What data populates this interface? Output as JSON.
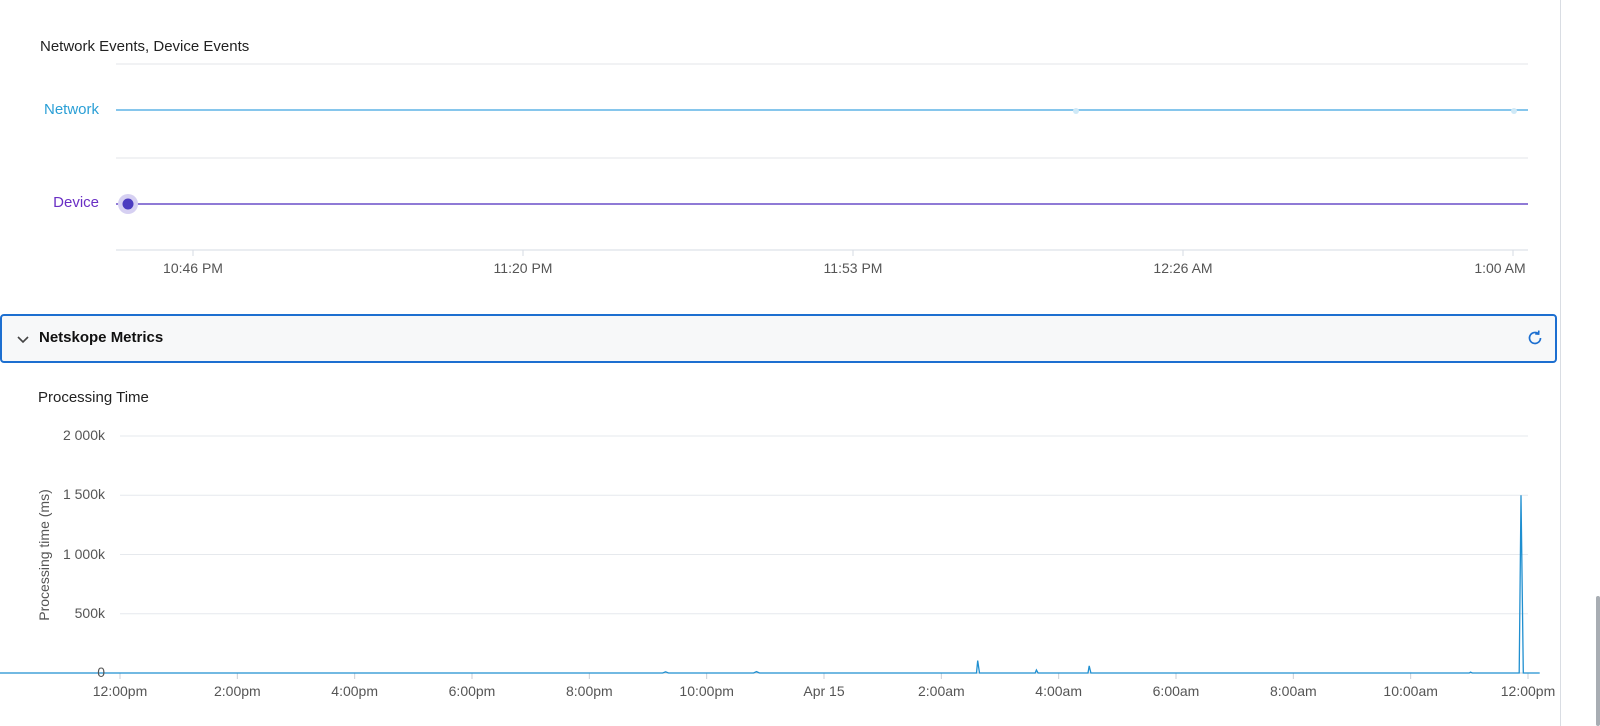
{
  "events_panel": {
    "title": "Network Events, Device Events",
    "lanes": [
      {
        "label": "Network",
        "color": "#2a9fd6"
      },
      {
        "label": "Device",
        "color": "#6a2fc4"
      }
    ],
    "time_ticks": [
      "10:46 PM",
      "11:20 PM",
      "11:53 PM",
      "12:26 AM",
      "1:00 AM"
    ]
  },
  "section": {
    "title": "Netskope Metrics",
    "collapse_icon": "chevron-down-icon",
    "refresh_icon": "refresh-icon",
    "accent_color": "#1d6fd0"
  },
  "processing_chart": {
    "title": "Processing Time"
  },
  "chart_data": {
    "type": "line",
    "title": "Processing Time",
    "xlabel": "",
    "ylabel": "Processing time (ms)",
    "ylim": [
      0,
      2000000
    ],
    "y_ticks": [
      "0",
      "500k",
      "1 000k",
      "1 500k",
      "2 000k"
    ],
    "x_ticks": [
      "12:00pm",
      "2:00pm",
      "4:00pm",
      "6:00pm",
      "8:00pm",
      "10:00pm",
      "Apr 15",
      "2:00am",
      "4:00am",
      "6:00am",
      "8:00am",
      "10:00am",
      "12:00pm"
    ],
    "grid": true,
    "series": [
      {
        "color": "#1f8fd0",
        "points": [
          [
            0.25,
            0
          ],
          [
            21.25,
            0
          ],
          [
            21.3,
            10000
          ],
          [
            21.35,
            0
          ],
          [
            22.8,
            0
          ],
          [
            22.85,
            12000
          ],
          [
            22.9,
            0
          ],
          [
            26.6,
            0
          ],
          [
            26.62,
            105000
          ],
          [
            26.65,
            0
          ],
          [
            27.6,
            0
          ],
          [
            27.62,
            25000
          ],
          [
            27.65,
            0
          ],
          [
            28.5,
            0
          ],
          [
            28.52,
            60000
          ],
          [
            28.55,
            0
          ],
          [
            35.0,
            0
          ],
          [
            35.02,
            8000
          ],
          [
            35.05,
            0
          ],
          [
            35.85,
            0
          ],
          [
            35.88,
            1500000
          ],
          [
            35.92,
            0
          ],
          [
            36.2,
            0
          ]
        ]
      }
    ]
  }
}
